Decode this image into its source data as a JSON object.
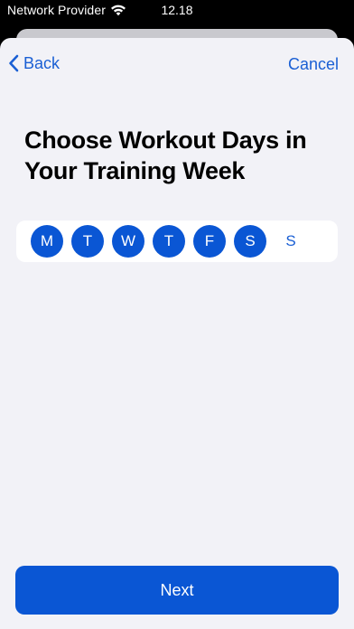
{
  "status_bar": {
    "carrier": "Network Provider",
    "time": "12.18"
  },
  "nav": {
    "back_label": "Back",
    "cancel_label": "Cancel"
  },
  "title": "Choose Workout Days in Your Training Week",
  "days": [
    {
      "label": "M",
      "selected": true
    },
    {
      "label": "T",
      "selected": true
    },
    {
      "label": "W",
      "selected": true
    },
    {
      "label": "T",
      "selected": true
    },
    {
      "label": "F",
      "selected": true
    },
    {
      "label": "S",
      "selected": true
    },
    {
      "label": "S",
      "selected": false
    }
  ],
  "next_label": "Next",
  "colors": {
    "accent": "#0a56d4",
    "link": "#1a5fd4",
    "background": "#f2f2f7"
  }
}
